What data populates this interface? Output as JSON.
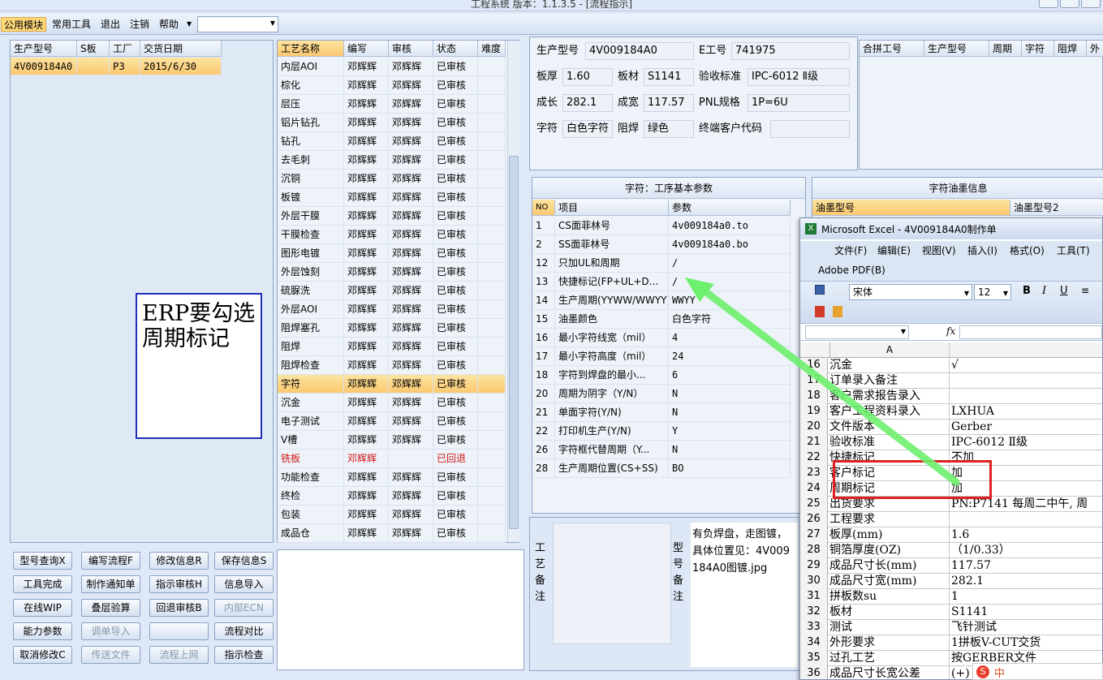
{
  "app": {
    "title": "工程系统 版本：1.1.3.5 - [流程指示]"
  },
  "menu": [
    {
      "label": "公用模块"
    },
    {
      "label": "常用工具"
    },
    {
      "label": "退出"
    },
    {
      "label": "注销"
    },
    {
      "label": "帮助"
    }
  ],
  "left_grid": {
    "headers": [
      "生产型号",
      "S板",
      "工厂",
      "交货日期"
    ],
    "rows": [
      [
        "4V009184A0",
        "",
        "P3",
        "2015/6/30"
      ]
    ]
  },
  "annotation": "ERP要勾选周期标记",
  "process": {
    "headers": [
      "工艺名称",
      "编写",
      "审核",
      "状态",
      "难度"
    ],
    "rows": [
      [
        "内层AOI",
        "邓辉辉",
        "邓辉辉",
        "已审核"
      ],
      [
        "棕化",
        "邓辉辉",
        "邓辉辉",
        "已审核"
      ],
      [
        "层压",
        "邓辉辉",
        "邓辉辉",
        "已审核"
      ],
      [
        "铝片钻孔",
        "邓辉辉",
        "邓辉辉",
        "已审核"
      ],
      [
        "钻孔",
        "邓辉辉",
        "邓辉辉",
        "已审核"
      ],
      [
        "去毛刺",
        "邓辉辉",
        "邓辉辉",
        "已审核"
      ],
      [
        "沉铜",
        "邓辉辉",
        "邓辉辉",
        "已审核"
      ],
      [
        "板镀",
        "邓辉辉",
        "邓辉辉",
        "已审核"
      ],
      [
        "外层干膜",
        "邓辉辉",
        "邓辉辉",
        "已审核"
      ],
      [
        "干膜检查",
        "邓辉辉",
        "邓辉辉",
        "已审核"
      ],
      [
        "图形电镀",
        "邓辉辉",
        "邓辉辉",
        "已审核"
      ],
      [
        "外层蚀刻",
        "邓辉辉",
        "邓辉辉",
        "已审核"
      ],
      [
        "硫脲洗",
        "邓辉辉",
        "邓辉辉",
        "已审核"
      ],
      [
        "外层AOI",
        "邓辉辉",
        "邓辉辉",
        "已审核"
      ],
      [
        "阻焊塞孔",
        "邓辉辉",
        "邓辉辉",
        "已审核"
      ],
      [
        "阻焊",
        "邓辉辉",
        "邓辉辉",
        "已审核"
      ],
      [
        "阻焊检查",
        "邓辉辉",
        "邓辉辉",
        "已审核"
      ],
      [
        "字符",
        "邓辉辉",
        "邓辉辉",
        "已审核"
      ],
      [
        "沉金",
        "邓辉辉",
        "邓辉辉",
        "已审核"
      ],
      [
        "电子测试",
        "邓辉辉",
        "邓辉辉",
        "已审核"
      ],
      [
        "V槽",
        "邓辉辉",
        "邓辉辉",
        "已审核"
      ],
      [
        "铣板",
        "邓辉辉",
        "",
        "已回退"
      ],
      [
        "功能检查",
        "邓辉辉",
        "邓辉辉",
        "已审核"
      ],
      [
        "终检",
        "邓辉辉",
        "邓辉辉",
        "已审核"
      ],
      [
        "包装",
        "邓辉辉",
        "邓辉辉",
        "已审核"
      ],
      [
        "成品仓",
        "邓辉辉",
        "邓辉辉",
        "已审核"
      ]
    ]
  },
  "buttons": [
    [
      "型号查询X",
      "编写流程F",
      "修改信息R",
      "保存信息S"
    ],
    [
      "工具完成",
      "制作通知单",
      "指示审核H",
      "信息导入"
    ],
    [
      "在线WIP",
      "叠层验算",
      "回退审核B",
      "内部ECN"
    ],
    [
      "能力参数",
      "调单导入",
      "",
      "流程对比"
    ],
    [
      "取消修改C",
      "传送文件",
      "流程上网",
      "指示检查"
    ]
  ],
  "info": {
    "model_label": "生产型号",
    "model": "4V009184A0",
    "e_label": "E工号",
    "e": "741975",
    "thick_label": "板厚",
    "thick": "1.60",
    "mat_label": "板材",
    "mat": "S1141",
    "std_label": "验收标准",
    "std": "IPC-6012 Ⅱ级",
    "len_label": "成长",
    "len": "282.1",
    "wid_label": "成宽",
    "wid": "117.57",
    "pnl_label": "PNL规格",
    "pnl": "1P=6U",
    "char_label": "字符",
    "char": "白色字符",
    "mask_label": "阻焊",
    "mask": "绿色",
    "cust_label": "终端客户代码",
    "cust": ""
  },
  "combine_headers": [
    "合拼工号",
    "生产型号",
    "周期",
    "字符",
    "阻焊",
    "外"
  ],
  "params": {
    "title": "字符：工序基本参数",
    "headers": [
      "NO",
      "项目",
      "参数"
    ],
    "rows": [
      [
        "1",
        "CS面菲林号",
        "4v009184a0.to"
      ],
      [
        "2",
        "SS面菲林号",
        "4v009184a0.bo"
      ],
      [
        "12",
        "只加UL和周期",
        "/"
      ],
      [
        "13",
        "快捷标记(FP+UL+D...",
        "/"
      ],
      [
        "14",
        "生产周期(YYWW/WWYY)",
        "WWYY"
      ],
      [
        "15",
        "油墨颜色",
        "白色字符"
      ],
      [
        "16",
        "最小字符线宽（mil）",
        "4"
      ],
      [
        "17",
        "最小字符高度（mil）",
        "24"
      ],
      [
        "18",
        "字符到焊盘的最小...",
        "6"
      ],
      [
        "20",
        "周期为阴字（Y/N）",
        "N"
      ],
      [
        "21",
        "单面字符(Y/N)",
        "N"
      ],
      [
        "22",
        "打印机生产(Y/N)",
        "Y"
      ],
      [
        "26",
        "字符框代替周期（Y...",
        "N"
      ],
      [
        "28",
        "生产周期位置(CS+SS)",
        "BO"
      ]
    ]
  },
  "ink": {
    "title": "字符油墨信息",
    "headers": [
      "油墨型号",
      "油墨型号2"
    ]
  },
  "remarks": {
    "process_label": "工艺备注",
    "model_label": "型号备注",
    "model_text": "有负焊盘，走图镀，具体位置见：4V009184A0图镀.jpg"
  },
  "excel": {
    "title": "Microsoft Excel - 4V009184A0制作单",
    "menu": [
      "文件(F)",
      "编辑(E)",
      "视图(V)",
      "插入(I)",
      "格式(O)",
      "工具(T)"
    ],
    "pdf": "Adobe PDF(B)",
    "font": "宋体",
    "size": "12",
    "col_a": "A",
    "rows": [
      [
        "16",
        "沉金",
        "√"
      ],
      [
        "17",
        "订单录入备注",
        ""
      ],
      [
        "18",
        "客户需求报告录入",
        ""
      ],
      [
        "19",
        "客户工程资料录入",
        "LXHUA"
      ],
      [
        "20",
        "文件版本",
        "Gerber"
      ],
      [
        "21",
        "验收标准",
        "IPC-6012 Ⅱ级"
      ],
      [
        "22",
        "快捷标记",
        "不加"
      ],
      [
        "23",
        "客户标记",
        "加"
      ],
      [
        "24",
        "周期标记",
        "加"
      ],
      [
        "25",
        "出货要求",
        "PN:P7141 每周二中午, 周"
      ],
      [
        "26",
        "工程要求",
        ""
      ],
      [
        "27",
        "板厚(mm)",
        "1.6"
      ],
      [
        "28",
        "铜箔厚度(OZ)",
        "（1/0.33）"
      ],
      [
        "29",
        "成品尺寸长(mm)",
        "117.57"
      ],
      [
        "30",
        "成品尺寸宽(mm)",
        "282.1"
      ],
      [
        "31",
        "拼板数su",
        "1"
      ],
      [
        "32",
        "板材",
        "S1141"
      ],
      [
        "33",
        "测试",
        "飞针测试"
      ],
      [
        "34",
        "外形要求",
        "1拼板V-CUT交货"
      ],
      [
        "35",
        "过孔工艺",
        "按GERBER文件"
      ],
      [
        "36",
        "成品尺寸长宽公差",
        "(+)"
      ]
    ]
  },
  "ime": "中"
}
